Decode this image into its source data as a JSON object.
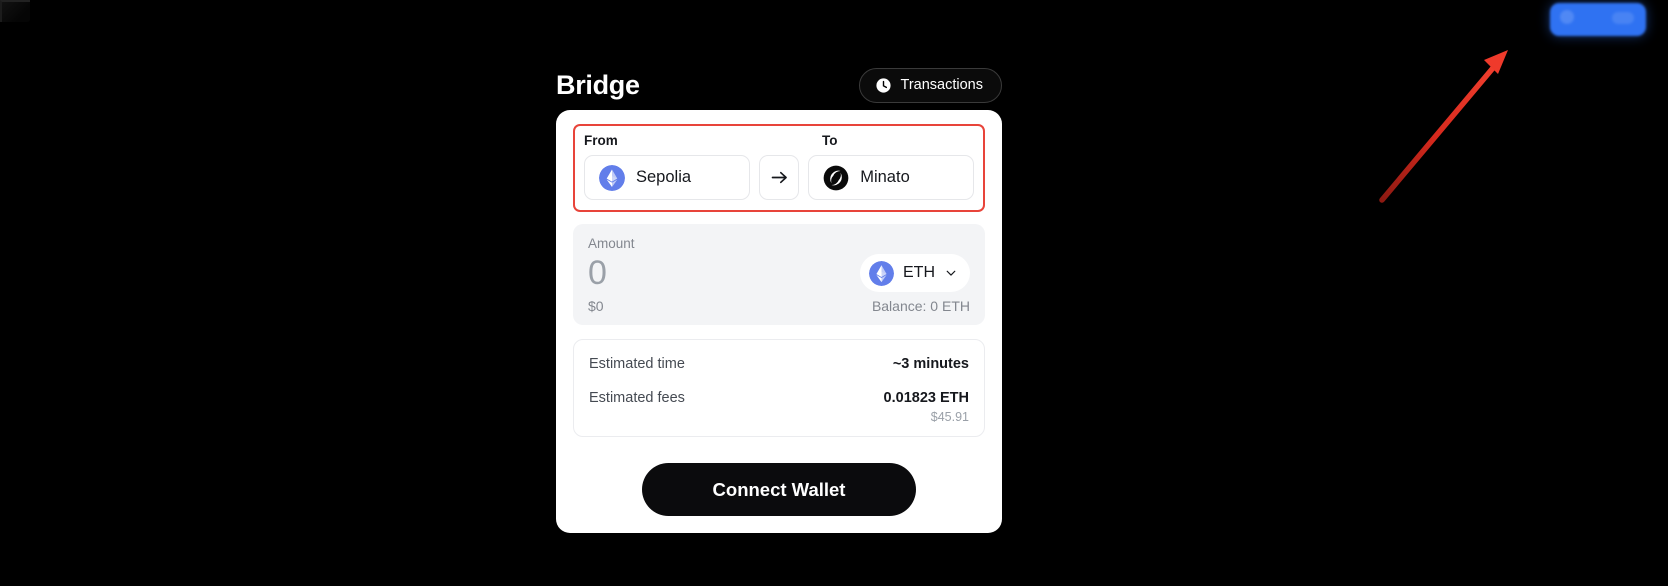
{
  "theme": {
    "page_background": "#000000",
    "card_background": "#ffffff",
    "highlight_border": "#e8443a",
    "annotation_arrow": "#e8342a",
    "accent_button": "#2f72f2",
    "cta_background": "#0b0b0d"
  },
  "header": {
    "title": "Bridge",
    "transactions_button": {
      "label": "Transactions",
      "icon": "clock-icon"
    }
  },
  "top_right": {
    "connect_button_label": ""
  },
  "route": {
    "from_label": "From",
    "to_label": "To",
    "from_chain": {
      "name": "Sepolia",
      "icon": "ethereum-logo-icon"
    },
    "to_chain": {
      "name": "Minato",
      "icon": "minato-logo-icon"
    },
    "swap_icon": "arrow-right-icon"
  },
  "amount": {
    "label": "Amount",
    "value": "0",
    "placeholder": "0",
    "usd_value": "$0",
    "balance": "Balance: 0 ETH",
    "token": {
      "symbol": "ETH",
      "icon": "ethereum-logo-icon",
      "chevron": "chevron-down-icon"
    }
  },
  "estimates": {
    "rows": [
      {
        "label": "Estimated time",
        "value": "~3 minutes",
        "sub": ""
      },
      {
        "label": "Estimated fees",
        "value": "0.01823 ETH",
        "sub": "$45.91"
      }
    ]
  },
  "cta": {
    "label": "Connect Wallet"
  }
}
